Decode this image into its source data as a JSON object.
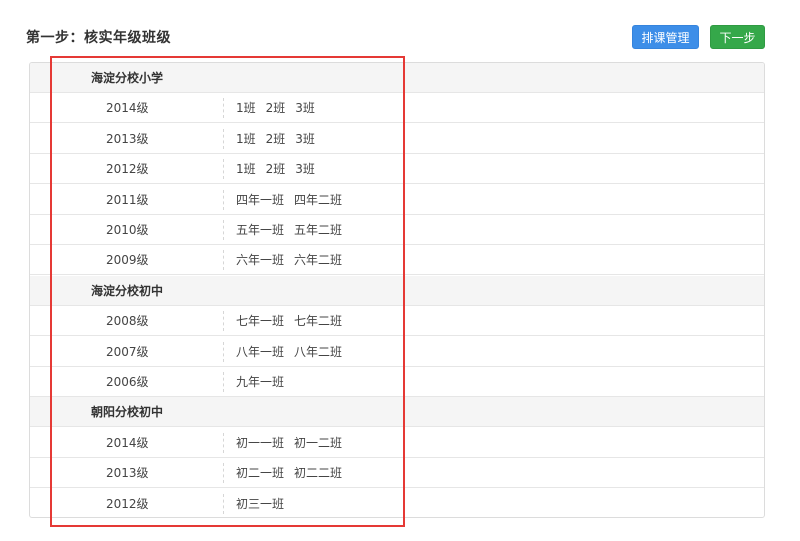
{
  "header": {
    "title": "第一步：核实年级班级",
    "schedule_button": "排课管理",
    "next_button": "下一步"
  },
  "colors": {
    "primary_button": "#3d8ee8",
    "next_button": "#35a84a",
    "highlight_border": "#e53935"
  },
  "schools": [
    {
      "name": "海淀分校小学",
      "grades": [
        {
          "grade": "2014级",
          "classes": [
            "1班",
            "2班",
            "3班"
          ]
        },
        {
          "grade": "2013级",
          "classes": [
            "1班",
            "2班",
            "3班"
          ]
        },
        {
          "grade": "2012级",
          "classes": [
            "1班",
            "2班",
            "3班"
          ]
        },
        {
          "grade": "2011级",
          "classes": [
            "四年一班",
            "四年二班"
          ]
        },
        {
          "grade": "2010级",
          "classes": [
            "五年一班",
            "五年二班"
          ]
        },
        {
          "grade": "2009级",
          "classes": [
            "六年一班",
            "六年二班"
          ]
        }
      ]
    },
    {
      "name": "海淀分校初中",
      "grades": [
        {
          "grade": "2008级",
          "classes": [
            "七年一班",
            "七年二班"
          ]
        },
        {
          "grade": "2007级",
          "classes": [
            "八年一班",
            "八年二班"
          ]
        },
        {
          "grade": "2006级",
          "classes": [
            "九年一班"
          ]
        }
      ]
    },
    {
      "name": "朝阳分校初中",
      "grades": [
        {
          "grade": "2014级",
          "classes": [
            "初一一班",
            "初一二班"
          ]
        },
        {
          "grade": "2013级",
          "classes": [
            "初二一班",
            "初二二班"
          ]
        },
        {
          "grade": "2012级",
          "classes": [
            "初三一班"
          ]
        }
      ]
    }
  ]
}
